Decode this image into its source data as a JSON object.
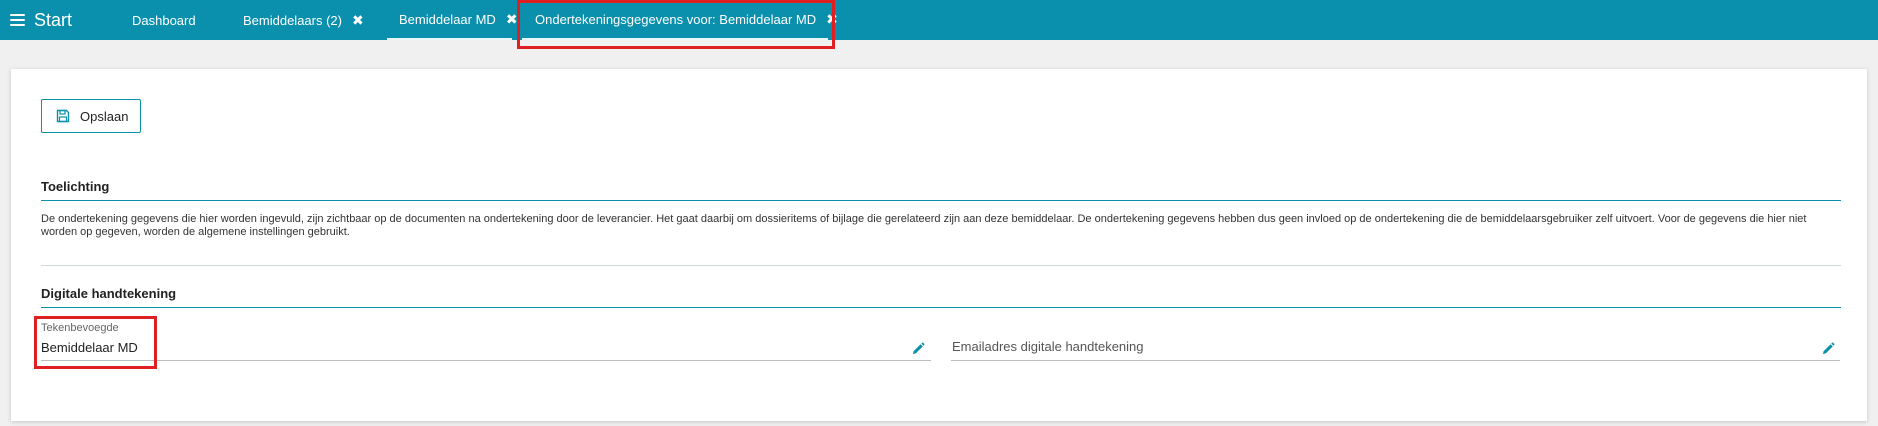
{
  "topbar": {
    "start_label": "Start",
    "tabs": [
      {
        "label": "Dashboard",
        "closable": false
      },
      {
        "label": "Bemiddelaars (2)",
        "closable": true
      },
      {
        "label": "Bemiddelaar MD",
        "closable": true
      },
      {
        "label": "Ondertekeningsgegevens voor: Bemiddelaar MD",
        "closable": true,
        "active": true
      }
    ],
    "close_glyph": "✖"
  },
  "toolbar": {
    "save_label": "Opslaan",
    "save_icon": "floppy-disk-icon"
  },
  "toelichting": {
    "title": "Toelichting",
    "text": "De ondertekening gegevens die hier worden ingevuld, zijn zichtbaar op de documenten na ondertekening door de leverancier. Het gaat daarbij om dossieritems of bijlage die gerelateerd zijn aan deze bemiddelaar. De ondertekening gegevens hebben dus geen invloed op de ondertekening die de bemiddelaarsgebruiker zelf uitvoert. Voor de gegevens die hier niet worden op gegeven, worden de algemene instellingen gebruikt."
  },
  "digitale_handtekening": {
    "title": "Digitale handtekening",
    "tekenbevoegde": {
      "label": "Tekenbevoegde",
      "value": "Bemiddelaar MD"
    },
    "emailadres": {
      "placeholder": "Emailadres digitale handtekening"
    }
  },
  "colors": {
    "brand": "#0a8fac",
    "highlight": "#e02020",
    "background": "#f0f0f0"
  }
}
